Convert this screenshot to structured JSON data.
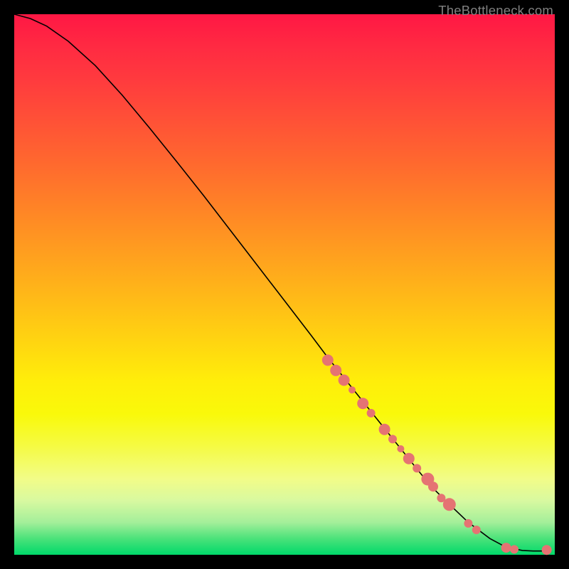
{
  "watermark": "TheBottleneck.com",
  "colors": {
    "marker": "#e57373",
    "curve": "#000000",
    "frame": "#000000"
  },
  "chart_data": {
    "type": "line",
    "title": "",
    "xlabel": "",
    "ylabel": "",
    "xlim": [
      0,
      100
    ],
    "ylim": [
      0,
      100
    ],
    "curve": [
      {
        "x": 0,
        "y": 100.0
      },
      {
        "x": 3,
        "y": 99.2
      },
      {
        "x": 6,
        "y": 97.8
      },
      {
        "x": 10,
        "y": 95.0
      },
      {
        "x": 15,
        "y": 90.5
      },
      {
        "x": 20,
        "y": 85.0
      },
      {
        "x": 25,
        "y": 79.0
      },
      {
        "x": 30,
        "y": 72.8
      },
      {
        "x": 35,
        "y": 66.5
      },
      {
        "x": 40,
        "y": 60.0
      },
      {
        "x": 45,
        "y": 53.5
      },
      {
        "x": 50,
        "y": 47.0
      },
      {
        "x": 55,
        "y": 40.5
      },
      {
        "x": 58,
        "y": 36.5
      },
      {
        "x": 62,
        "y": 31.5
      },
      {
        "x": 66,
        "y": 26.5
      },
      {
        "x": 70,
        "y": 21.5
      },
      {
        "x": 74,
        "y": 16.5
      },
      {
        "x": 77,
        "y": 12.8
      },
      {
        "x": 80,
        "y": 9.8
      },
      {
        "x": 84,
        "y": 6.0
      },
      {
        "x": 88,
        "y": 3.0
      },
      {
        "x": 91,
        "y": 1.4
      },
      {
        "x": 94,
        "y": 0.8
      },
      {
        "x": 96,
        "y": 0.7
      },
      {
        "x": 99,
        "y": 0.7
      }
    ],
    "markers": [
      {
        "x": 58.0,
        "y": 36.0,
        "r": 8
      },
      {
        "x": 59.5,
        "y": 34.1,
        "r": 8
      },
      {
        "x": 61.0,
        "y": 32.3,
        "r": 8
      },
      {
        "x": 62.5,
        "y": 30.5,
        "r": 5
      },
      {
        "x": 64.5,
        "y": 28.0,
        "r": 8
      },
      {
        "x": 66.0,
        "y": 26.2,
        "r": 6
      },
      {
        "x": 68.5,
        "y": 23.2,
        "r": 8
      },
      {
        "x": 70.0,
        "y": 21.4,
        "r": 6
      },
      {
        "x": 71.5,
        "y": 19.6,
        "r": 5
      },
      {
        "x": 73.0,
        "y": 17.8,
        "r": 8
      },
      {
        "x": 74.5,
        "y": 16.0,
        "r": 6
      },
      {
        "x": 76.5,
        "y": 14.0,
        "r": 9
      },
      {
        "x": 77.5,
        "y": 12.6,
        "r": 7
      },
      {
        "x": 79.0,
        "y": 10.5,
        "r": 6
      },
      {
        "x": 80.5,
        "y": 9.3,
        "r": 9
      },
      {
        "x": 84.0,
        "y": 5.8,
        "r": 6
      },
      {
        "x": 85.5,
        "y": 4.6,
        "r": 6
      },
      {
        "x": 91.0,
        "y": 1.3,
        "r": 7
      },
      {
        "x": 92.5,
        "y": 1.0,
        "r": 6
      },
      {
        "x": 98.5,
        "y": 0.9,
        "r": 7
      }
    ]
  }
}
